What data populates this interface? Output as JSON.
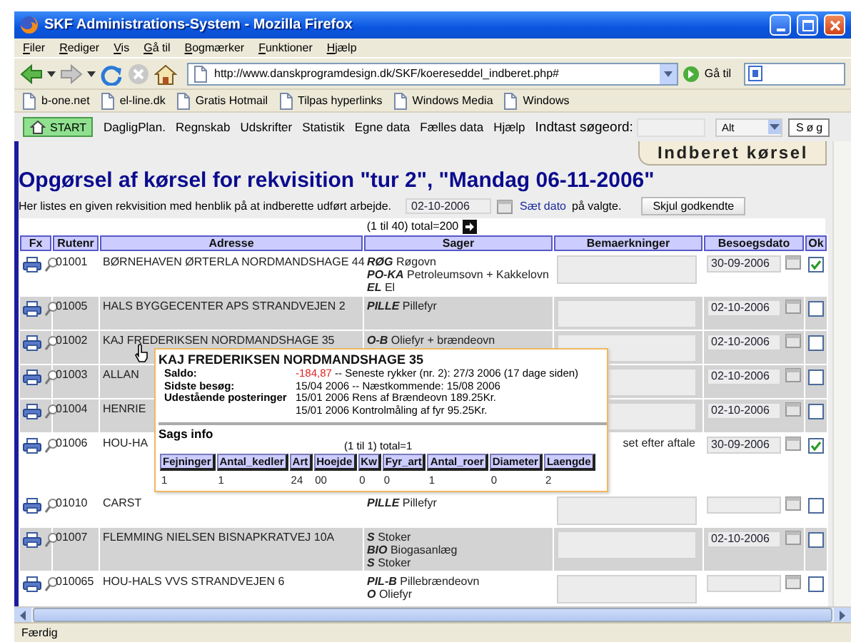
{
  "window": {
    "title": "SKF Administrations-System - Mozilla Firefox"
  },
  "menu": [
    "Filer",
    "Rediger",
    "Vis",
    "Gå til",
    "Bogmærker",
    "Funktioner",
    "Hjælp"
  ],
  "toolbar": {
    "url": "http://www.danskprogramdesign.dk/SKF/koereseddel_indberet.php#",
    "go_label": "Gå til"
  },
  "bookmarks": [
    "b-one.net",
    "el-line.dk",
    "Gratis Hotmail",
    "Tilpas hyperlinks",
    "Windows Media",
    "Windows"
  ],
  "app_nav": {
    "start": "START",
    "items": [
      "DagligPlan.",
      "Regnskab",
      "Udskrifter",
      "Statistik",
      "Egne data",
      "Fælles data",
      "Hjælp"
    ],
    "search_label": "Indtast søgeord:",
    "scope": "Alt",
    "search_button": "Søg"
  },
  "page_tab": "Indberet kørsel",
  "heading": "Opgørsel af kørsel for rekvisition \"tur 2\", \"Mandag 06-11-2006\"",
  "info": {
    "text": "Her listes en given rekvisition med henblik på at indberette udført arbejde.",
    "date": "02-10-2006",
    "link": "Sæt dato",
    "suffix": "på valgte.",
    "button": "Skjul godkendte"
  },
  "pager": "(1 til 40) total=200",
  "table": {
    "columns": [
      "Fx",
      "Rutenr",
      "Adresse",
      "Sager",
      "Bemaerkninger",
      "Besoegsdato",
      "Ok"
    ],
    "rows": [
      {
        "rutenr": "01001",
        "adresse": "BØRNEHAVEN ØRTERLA NORDMANDSHAGE 44",
        "sager": [
          "**RØG** Røgovn",
          "**PO-KA** Petroleumsovn + Kakkelovn",
          "**EL** El"
        ],
        "besoegsdato": "30-09-2006",
        "ok": true,
        "shaded": false
      },
      {
        "rutenr": "01005",
        "adresse": "HALS BYGGECENTER APS STRANDVEJEN 2",
        "sager": [
          "**PILLE** Pillefyr"
        ],
        "besoegsdato": "02-10-2006",
        "ok": false,
        "shaded": true
      },
      {
        "rutenr": "01002",
        "adresse": "KAJ FREDERIKSEN NORDMANDSHAGE 35",
        "sager": [
          "**O-B** Oliefyr + brændeovn"
        ],
        "besoegsdato": "02-10-2006",
        "ok": false,
        "shaded": true
      },
      {
        "rutenr": "01003",
        "adresse": "ALLAN",
        "besoegsdato": "02-10-2006",
        "ok": false,
        "shaded": true
      },
      {
        "rutenr": "01004",
        "adresse": "HENRIE",
        "besoegsdato": "02-10-2006",
        "ok": false,
        "shaded": true
      },
      {
        "rutenr": "01006",
        "adresse": "HOU-HA",
        "bemaerkninger": "set efter aftale",
        "besoegsdato": "30-09-2006",
        "ok": true,
        "shaded": false
      },
      {
        "rutenr": "01010",
        "adresse": "CARST",
        "sager": [
          "**PILLE** Pillefyr"
        ],
        "ok": false,
        "shaded": false
      },
      {
        "rutenr": "01007",
        "adresse": "FLEMMING NIELSEN BISNAPKRATVEJ 10A",
        "sager": [
          "**S** Stoker",
          "**BIO** Biogasanlæg",
          "**S** Stoker"
        ],
        "besoegsdato": "02-10-2006",
        "ok": false,
        "shaded": true
      },
      {
        "rutenr": "010065",
        "adresse": "HOU-HALS VVS STRANDVEJEN 6",
        "sager": [
          "**PIL-B** Pillebrændeovn",
          "**O** Oliefyr"
        ],
        "ok": false,
        "shaded": false
      }
    ]
  },
  "popup": {
    "title": "KAJ FREDERIKSEN NORDMANDSHAGE 35",
    "saldo": {
      "label": "Saldo:",
      "amount": "-184,87",
      "detail": "-- Seneste rykker (nr. 2): 27/3 2006 (17 dage siden)"
    },
    "details": [
      {
        "label": "Sidste besøg:",
        "lines": [
          "15/04 2006 -- Næstkommende: 15/08 2006"
        ]
      },
      {
        "label": "Udestående posteringer",
        "lines": [
          "15/01 2006 Rens af Brændeovn 189.25Kr.",
          "15/01 2006 Kontrolmåling af fyr 95.25Kr."
        ]
      }
    ],
    "section": "Sags info",
    "pager": "(1 til 1) total=1",
    "columns": [
      "Fejninger",
      "Antal_kedler",
      "Art",
      "Hoejde",
      "Kw",
      "Fyr_art",
      "Antal_roer",
      "Diameter",
      "Laengde"
    ],
    "rows": [
      [
        "1",
        "1",
        "24",
        "00",
        "0",
        "0",
        "1",
        "0",
        "2"
      ]
    ]
  },
  "status_bar": "Færdig"
}
